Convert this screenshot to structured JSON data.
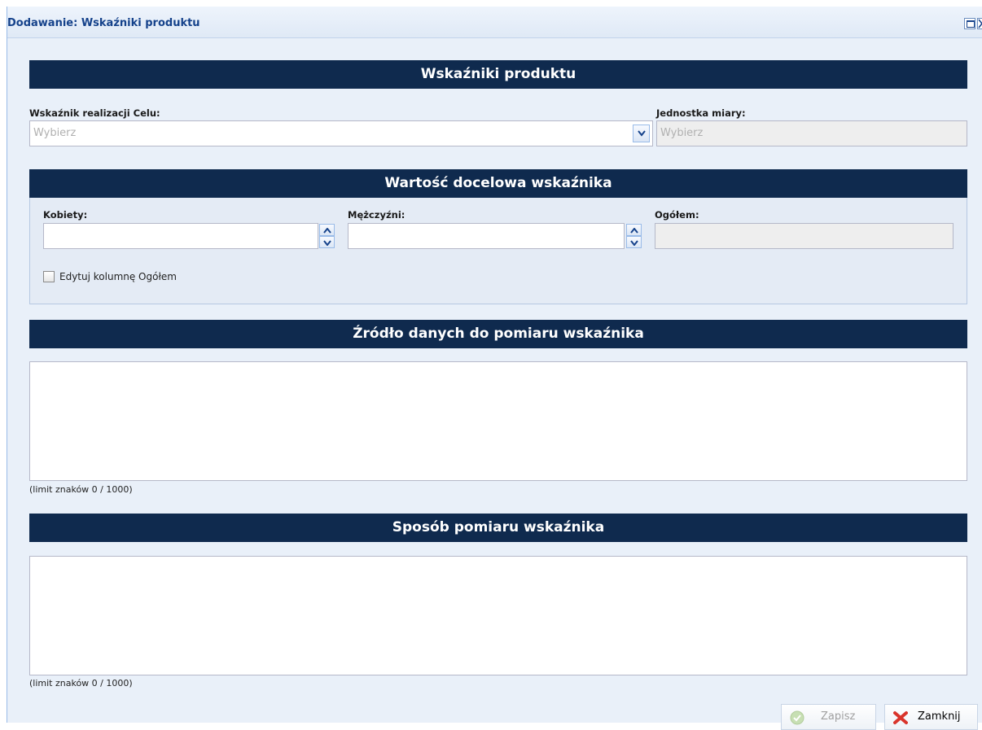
{
  "window": {
    "title": "Dodawanie: Wskaźniki produktu",
    "maximize_icon": "maximize-icon",
    "close_icon": "close-icon"
  },
  "sections": {
    "indicators": "Wskaźniki produktu",
    "target_value": "Wartość docelowa wskaźnika",
    "data_source": "Źródło danych do pomiaru wskaźnika",
    "measurement_method": "Sposób pomiaru wskaźnika"
  },
  "indicator": {
    "label": "Wskaźnik realizacji Celu:",
    "placeholder": "Wybierz"
  },
  "unit": {
    "label": "Jednostka miary:",
    "placeholder": "Wybierz"
  },
  "target": {
    "women_label": "Kobiety:",
    "women_value": "",
    "men_label": "Mężczyźni:",
    "men_value": "",
    "total_label": "Ogółem:",
    "total_value": "",
    "edit_total_label": "Edytuj kolumnę Ogółem",
    "edit_total_checked": false
  },
  "data_source": {
    "value": "",
    "limit": "(limit znaków 0 / 1000)"
  },
  "measurement_method": {
    "value": "",
    "limit": "(limit znaków 0 / 1000)"
  },
  "buttons": {
    "save": "Zapisz",
    "save_enabled": false,
    "close": "Zamknij"
  },
  "colors": {
    "header_bg": "#0f2a4e",
    "title_text": "#15428b",
    "panel_bg": "#e9f0f9"
  }
}
